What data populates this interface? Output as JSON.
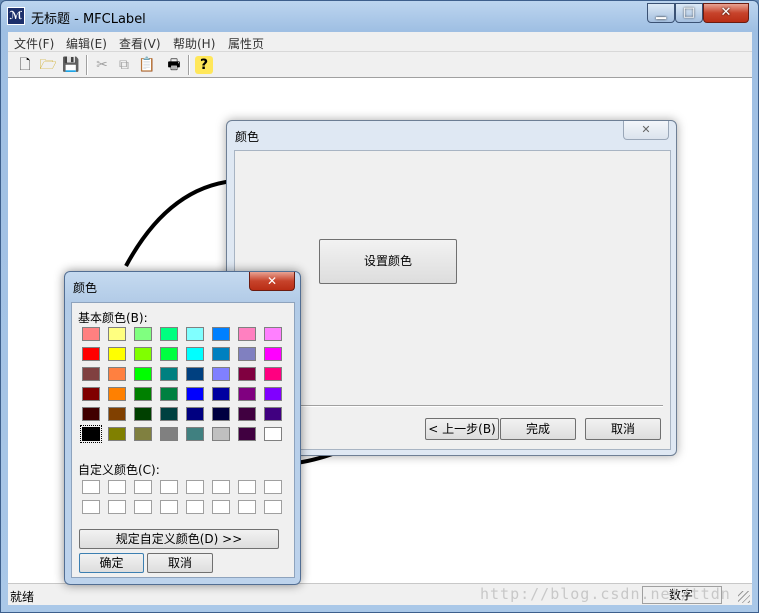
{
  "window": {
    "title": "无标题 - MFCLabel",
    "app_icon": "app-icon",
    "min": "▁",
    "max": "□",
    "close": "✕"
  },
  "menu": [
    "文件(F)",
    "编辑(E)",
    "查看(V)",
    "帮助(H)",
    "属性页"
  ],
  "toolbar": {
    "icons": [
      "new-file-icon",
      "open-folder-icon",
      "save-disk-icon",
      "cut-icon",
      "copy-icon",
      "paste-icon",
      "print-icon",
      "help-icon"
    ],
    "glyphs": [
      "🗋",
      "🗁",
      "💾",
      "✂",
      "⧉",
      "📋",
      "🖶",
      "?"
    ]
  },
  "status": {
    "text": "就绪",
    "pane": "数字"
  },
  "wizard": {
    "title": "颜色",
    "close": "✕",
    "set_color": "设置颜色",
    "back": "< 上一步(B)",
    "finish": "完成",
    "cancel": "取消"
  },
  "color_dialog": {
    "title": "颜色",
    "close": "✕",
    "basic_label": "基本颜色(B):",
    "custom_label": "自定义颜色(C):",
    "define_custom": "规定自定义颜色(D) >>",
    "ok": "确定",
    "cancel": "取消",
    "basic_colors": [
      [
        "#ff8080",
        "#ffff80",
        "#80ff80",
        "#00ff80",
        "#80ffff",
        "#0080ff",
        "#ff80c0",
        "#ff80ff"
      ],
      [
        "#ff0000",
        "#ffff00",
        "#80ff00",
        "#00ff40",
        "#00ffff",
        "#0080c0",
        "#8080c0",
        "#ff00ff"
      ],
      [
        "#804040",
        "#ff8040",
        "#00ff00",
        "#008080",
        "#004080",
        "#8080ff",
        "#800040",
        "#ff0080"
      ],
      [
        "#800000",
        "#ff8000",
        "#008000",
        "#008040",
        "#0000ff",
        "#0000a0",
        "#800080",
        "#8000ff"
      ],
      [
        "#400000",
        "#804000",
        "#004000",
        "#004040",
        "#000080",
        "#000040",
        "#400040",
        "#400080"
      ],
      [
        "#000000",
        "#808000",
        "#808040",
        "#808080",
        "#408080",
        "#c0c0c0",
        "#400040",
        "#ffffff"
      ]
    ],
    "selected": "#000000"
  },
  "watermark": "http://blog.csdn.net/ttdn"
}
